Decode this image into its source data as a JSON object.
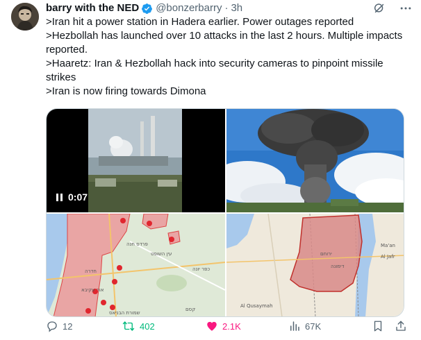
{
  "author": {
    "display_name": "barry with the NED",
    "handle": "@bonzerbarry",
    "separator": "·",
    "time": "3h"
  },
  "tweet": {
    "lines": [
      ">Iran hit a power station in Hadera earlier. Power outages reported",
      ">Hezbollah has launched over 10 attacks in the last 2 hours. Multiple impacts reported.",
      ">Haaretz: Iran & Hezbollah hack into security cameras to pinpoint missile strikes",
      ">Iran is now firing towards Dimona"
    ]
  },
  "media": {
    "video_time": "0:07",
    "map1_labels": [
      "עין השופט",
      "חדרה",
      "כפר יונה",
      "אור עקיבא",
      "פרדס חנה",
      "שמורת הבניאס",
      "קסם"
    ],
    "map2_labels": [
      "ירוחם",
      "דימונה",
      "Al Qusaymah",
      "Ma'an",
      "Al Jafr"
    ]
  },
  "actions": {
    "replies": "12",
    "retweets": "402",
    "likes": "2.1K",
    "views": "67K"
  },
  "colors": {
    "text": "#0f1419",
    "muted": "#536471",
    "verified": "#1d9bf0",
    "retweet": "#00ba7c",
    "like": "#f91880",
    "border": "#cfd9de"
  }
}
